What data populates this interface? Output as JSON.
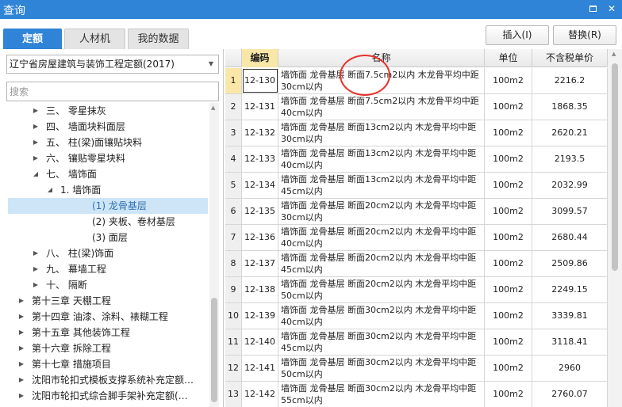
{
  "window": {
    "title": "查询"
  },
  "tabs": [
    {
      "label": "定额",
      "active": true
    },
    {
      "label": "人材机",
      "active": false
    },
    {
      "label": "我的数据",
      "active": false
    }
  ],
  "toolbar": {
    "insert_label": "插入(I)",
    "replace_label": "替换(R)"
  },
  "left": {
    "dropdown_value": "辽宁省房屋建筑与装饰工程定额(2017)",
    "search_placeholder": "搜索",
    "tree": [
      {
        "label": "三、 零星抹灰",
        "level": 2,
        "expander": "▶"
      },
      {
        "label": "四、 墙面块料面层",
        "level": 2,
        "expander": "▶"
      },
      {
        "label": "五、 柱(梁)面镶贴块料",
        "level": 2,
        "expander": "▶"
      },
      {
        "label": "六、 镶贴零星块料",
        "level": 2,
        "expander": "▶"
      },
      {
        "label": "七、 墙饰面",
        "level": 2,
        "expander": "◢"
      },
      {
        "label": "1. 墙饰面",
        "level": 3,
        "expander": "◢"
      },
      {
        "label": "(1) 龙骨基层",
        "level": 4,
        "expander": "",
        "selected": true
      },
      {
        "label": "(2) 夹板、卷材基层",
        "level": 4,
        "expander": ""
      },
      {
        "label": "(3) 面层",
        "level": 4,
        "expander": ""
      },
      {
        "label": "八、 柱(梁)饰面",
        "level": 2,
        "expander": "▶"
      },
      {
        "label": "九、 幕墙工程",
        "level": 2,
        "expander": "▶"
      },
      {
        "label": "十、 隔断",
        "level": 2,
        "expander": "▶"
      },
      {
        "label": "第十三章 天棚工程",
        "level": 1,
        "expander": "▶"
      },
      {
        "label": "第十四章 油漆、涂料、裱糊工程",
        "level": 1,
        "expander": "▶"
      },
      {
        "label": "第十五章 其他装饰工程",
        "level": 1,
        "expander": "▶"
      },
      {
        "label": "第十六章 拆除工程",
        "level": 1,
        "expander": "▶"
      },
      {
        "label": "第十七章 措施项目",
        "level": 1,
        "expander": "▶"
      },
      {
        "label": "沈阳市轮扣式模板支撑系统补充定额…",
        "level": 1,
        "expander": "▶"
      },
      {
        "label": "沈阳市轮扣式综合脚手架补充定额(…",
        "level": 1,
        "expander": "▶"
      }
    ]
  },
  "grid": {
    "headers": {
      "code": "编码",
      "name": "名称",
      "unit": "单位",
      "price": "不含税单价"
    },
    "rows": [
      {
        "idx": "1",
        "code": "12-130",
        "name": "墙饰面 龙骨基层 断面7.5cm2以内 木龙骨平均中距 30cm以内",
        "unit": "100m2",
        "price": "2216.2"
      },
      {
        "idx": "2",
        "code": "12-131",
        "name": "墙饰面 龙骨基层 断面7.5cm2以内 木龙骨平均中距 40cm以内",
        "unit": "100m2",
        "price": "1868.35"
      },
      {
        "idx": "3",
        "code": "12-132",
        "name": "墙饰面 龙骨基层 断面13cm2以内 木龙骨平均中距 30cm以内",
        "unit": "100m2",
        "price": "2620.21"
      },
      {
        "idx": "4",
        "code": "12-133",
        "name": "墙饰面 龙骨基层 断面13cm2以内 木龙骨平均中距 40cm以内",
        "unit": "100m2",
        "price": "2193.5"
      },
      {
        "idx": "5",
        "code": "12-134",
        "name": "墙饰面 龙骨基层 断面13cm2以内 木龙骨平均中距 45cm以内",
        "unit": "100m2",
        "price": "2032.99"
      },
      {
        "idx": "6",
        "code": "12-135",
        "name": "墙饰面 龙骨基层 断面20cm2以内 木龙骨平均中距 30cm以内",
        "unit": "100m2",
        "price": "3099.57"
      },
      {
        "idx": "7",
        "code": "12-136",
        "name": "墙饰面 龙骨基层 断面20cm2以内 木龙骨平均中距 40cm以内",
        "unit": "100m2",
        "price": "2680.44"
      },
      {
        "idx": "8",
        "code": "12-137",
        "name": "墙饰面 龙骨基层 断面20cm2以内 木龙骨平均中距 45cm以内",
        "unit": "100m2",
        "price": "2509.86"
      },
      {
        "idx": "9",
        "code": "12-138",
        "name": "墙饰面 龙骨基层 断面20cm2以内 木龙骨平均中距 50cm以内",
        "unit": "100m2",
        "price": "2249.15"
      },
      {
        "idx": "10",
        "code": "12-139",
        "name": "墙饰面 龙骨基层 断面30cm2以内 木龙骨平均中距 40cm以内",
        "unit": "100m2",
        "price": "3339.81"
      },
      {
        "idx": "11",
        "code": "12-140",
        "name": "墙饰面 龙骨基层 断面30cm2以内 木龙骨平均中距 45cm以内",
        "unit": "100m2",
        "price": "3118.41"
      },
      {
        "idx": "12",
        "code": "12-141",
        "name": "墙饰面 龙骨基层 断面30cm2以内 木龙骨平均中距 50cm以内",
        "unit": "100m2",
        "price": "2960"
      },
      {
        "idx": "13",
        "code": "12-142",
        "name": "墙饰面 龙骨基层 断面30cm2以内 木龙骨平均中距 55cm以内",
        "unit": "100m2",
        "price": "2760.07"
      }
    ]
  },
  "colors": {
    "accent": "#2f84d8",
    "highlight": "#f9e7a8",
    "annotation": "#e8312a"
  }
}
